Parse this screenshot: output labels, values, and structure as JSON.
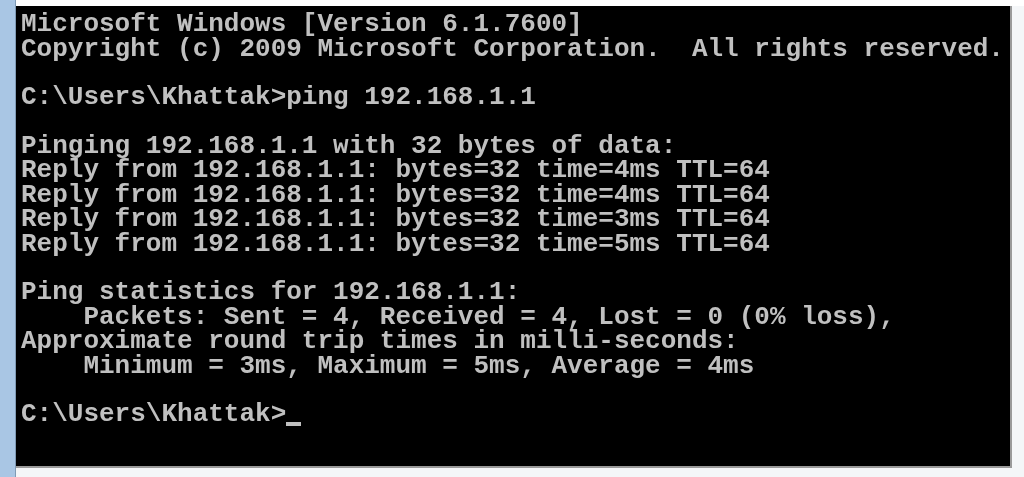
{
  "console": {
    "blocks": [
      [
        "Microsoft Windows [Version 6.1.7600]",
        "Copyright (c) 2009 Microsoft Corporation.  All rights reserved."
      ],
      [
        "C:\\Users\\Khattak>ping 192.168.1.1"
      ],
      [
        "Pinging 192.168.1.1 with 32 bytes of data:",
        "Reply from 192.168.1.1: bytes=32 time=4ms TTL=64",
        "Reply from 192.168.1.1: bytes=32 time=4ms TTL=64",
        "Reply from 192.168.1.1: bytes=32 time=3ms TTL=64",
        "Reply from 192.168.1.1: bytes=32 time=5ms TTL=64"
      ],
      [
        "Ping statistics for 192.168.1.1:",
        "    Packets: Sent = 4, Received = 4, Lost = 0 (0% loss),",
        "Approximate round trip times in milli-seconds:",
        "    Minimum = 3ms, Maximum = 5ms, Average = 4ms"
      ],
      [
        "C:\\Users\\Khattak>"
      ]
    ],
    "cursor": true
  }
}
